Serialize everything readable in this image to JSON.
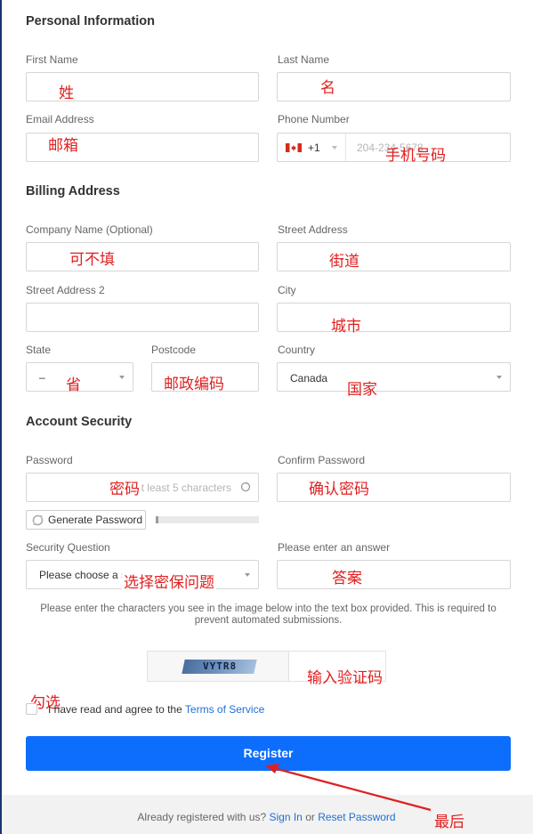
{
  "sections": {
    "personal": "Personal Information",
    "billing": "Billing Address",
    "security": "Account Security"
  },
  "fields": {
    "first_name": {
      "label": "First Name",
      "annotation": "姓"
    },
    "last_name": {
      "label": "Last Name",
      "annotation": "名"
    },
    "email": {
      "label": "Email Address",
      "annotation": "邮箱"
    },
    "phone": {
      "label": "Phone Number",
      "country_code": "+1",
      "placeholder": "204-234-5678",
      "annotation": "手机号码"
    },
    "company": {
      "label": "Company Name (Optional)",
      "annotation": "可不填"
    },
    "street": {
      "label": "Street Address",
      "annotation": "街道"
    },
    "street2": {
      "label": "Street Address 2"
    },
    "city": {
      "label": "City",
      "annotation": "城市"
    },
    "state": {
      "label": "State",
      "value": "–",
      "annotation": "省"
    },
    "postcode": {
      "label": "Postcode",
      "annotation": "邮政编码"
    },
    "country": {
      "label": "Country",
      "value": "Canada",
      "annotation": "国家"
    },
    "password": {
      "label": "Password",
      "placeholder": "At least 5 characters",
      "annotation": "密码"
    },
    "confirm_password": {
      "label": "Confirm Password",
      "annotation": "确认密码"
    },
    "security_question": {
      "label": "Security Question",
      "value": "Please choose a security question",
      "annotation": "选择密保问题"
    },
    "answer": {
      "label": "Please enter an answer",
      "annotation": "答案"
    }
  },
  "generate_password": "Generate Password",
  "password_strength": 0.03,
  "captcha": {
    "instructions": "Please enter the characters you see in the image below into the text box provided. This is required to prevent automated submissions.",
    "code": "VYTR8",
    "annotation": "输入验证码"
  },
  "terms": {
    "annotation": "勾选",
    "prefix": "I have read and agree to the ",
    "link": "Terms of Service"
  },
  "register": {
    "label": "Register",
    "annotation": "最后"
  },
  "footer": {
    "prefix": "Already registered with us? ",
    "sign_in": "Sign In",
    "or": " or ",
    "reset": "Reset Password"
  },
  "colors": {
    "primary": "#0d6efd",
    "link": "#1f6fd4",
    "annotation": "#e02020",
    "edge": "#1c3470"
  },
  "icons": {
    "flag": "canada-flag-icon",
    "refresh": "refresh-icon",
    "dropdown": "chevron-down-icon"
  }
}
